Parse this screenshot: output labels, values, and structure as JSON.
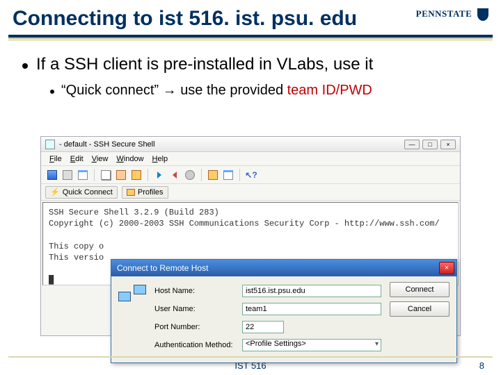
{
  "slide": {
    "title": "Connecting to ist 516. ist. psu. edu",
    "brand": "PENNSTATE",
    "bullet1": "If a SSH client is pre-installed in VLabs, use it",
    "bullet2_quote": "“Quick connect”",
    "bullet2_arrow": " → ",
    "bullet2_rest": "use the provided ",
    "bullet2_red": "team ID/PWD",
    "footer_center": "IST 516",
    "footer_page": "8"
  },
  "ssh_window": {
    "title": "- default - SSH Secure Shell",
    "menu": {
      "file": "File",
      "edit": "Edit",
      "view": "View",
      "window": "Window",
      "help": "Help"
    },
    "qc_label": "Quick Connect",
    "profiles_label": "Profiles",
    "terminal_line1": "SSH Secure Shell 3.2.9 (Build 283)",
    "terminal_line2": "Copyright (c) 2000-2003 SSH Communications Security Corp - http://www.ssh.com/",
    "terminal_line3": "",
    "terminal_line4": "This copy o",
    "terminal_line5": "This versio"
  },
  "dialog": {
    "title": "Connect to Remote Host",
    "host_label": "Host Name:",
    "host_value": "ist516.ist.psu.edu",
    "user_label": "User Name:",
    "user_value": "team1",
    "port_label": "Port Number:",
    "port_value": "22",
    "auth_label": "Authentication Method:",
    "auth_value": "<Profile Settings>",
    "connect": "Connect",
    "cancel": "Cancel"
  }
}
